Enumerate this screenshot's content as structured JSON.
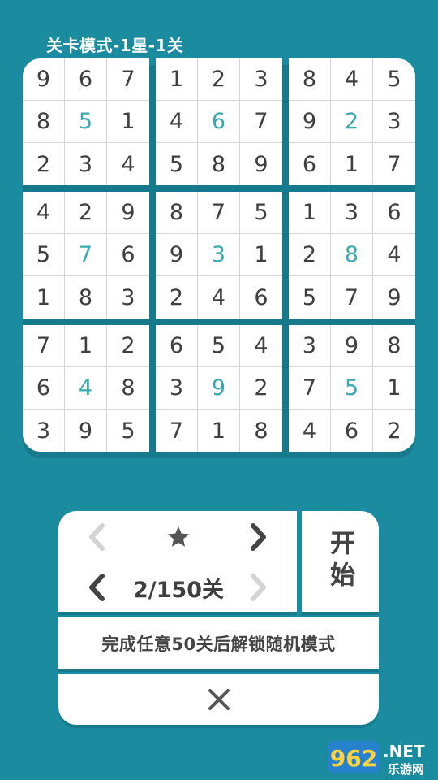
{
  "header": {
    "title": "关卡模式-1星-1关"
  },
  "board": {
    "rows": [
      [
        "9",
        "6",
        "7",
        "1",
        "2",
        "3",
        "8",
        "4",
        "5"
      ],
      [
        "8",
        "5",
        "1",
        "4",
        "6",
        "7",
        "9",
        "2",
        "3"
      ],
      [
        "2",
        "3",
        "4",
        "5",
        "8",
        "9",
        "6",
        "1",
        "7"
      ],
      [
        "4",
        "2",
        "9",
        "8",
        "7",
        "5",
        "1",
        "3",
        "6"
      ],
      [
        "5",
        "7",
        "6",
        "9",
        "3",
        "1",
        "2",
        "8",
        "4"
      ],
      [
        "1",
        "8",
        "3",
        "2",
        "4",
        "6",
        "5",
        "7",
        "9"
      ],
      [
        "7",
        "1",
        "2",
        "6",
        "5",
        "4",
        "3",
        "9",
        "8"
      ],
      [
        "6",
        "4",
        "8",
        "3",
        "9",
        "2",
        "7",
        "5",
        "1"
      ],
      [
        "3",
        "9",
        "5",
        "7",
        "1",
        "8",
        "4",
        "6",
        "2"
      ]
    ],
    "highlight_cells": [
      [
        1,
        1
      ],
      [
        1,
        4
      ],
      [
        1,
        7
      ],
      [
        4,
        1
      ],
      [
        4,
        4
      ],
      [
        4,
        7
      ],
      [
        7,
        1
      ],
      [
        7,
        4
      ],
      [
        7,
        7
      ]
    ],
    "colors": {
      "digit": "#3f3f3f",
      "highlight": "#3aa8b4",
      "background": "#1b8ba0"
    }
  },
  "controls": {
    "star_icon": "star-icon",
    "level_label": "2/150关",
    "start_label": "开始",
    "unlock_text": "完成任意50关后解锁随机模式",
    "close_icon": "close-icon"
  },
  "watermark": {
    "text_number": "962",
    "text_net": ".NET",
    "text_site": "乐游网"
  }
}
